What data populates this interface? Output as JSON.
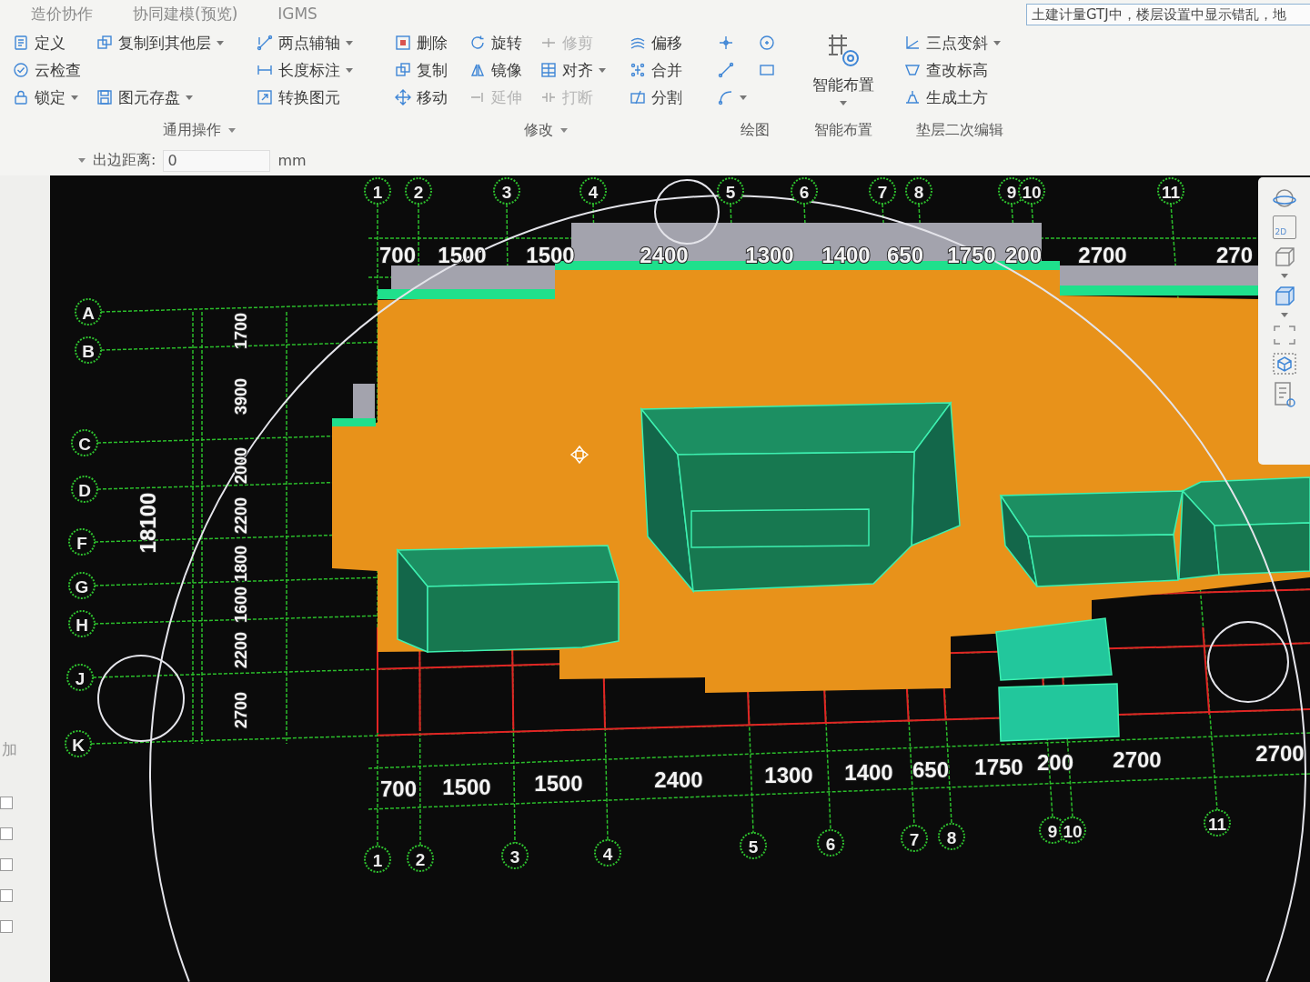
{
  "tabs": [
    {
      "label": "造价协作",
      "selected": false
    },
    {
      "label": "协同建模(预览)",
      "selected": false
    },
    {
      "label": "IGMS",
      "selected": false
    }
  ],
  "search": {
    "value": "土建计量GTJ中，楼层设置中显示错乱，地"
  },
  "ribbon": [
    {
      "label": "通用操作",
      "dropdown": true,
      "kind": "columns",
      "columns": [
        [
          {
            "label": "定义",
            "dropdown": false,
            "disabled": false
          },
          {
            "label": "云检查",
            "dropdown": false,
            "disabled": false
          },
          {
            "label": "锁定",
            "dropdown": true,
            "disabled": false
          }
        ],
        [
          {
            "label": "复制到其他层",
            "dropdown": true,
            "disabled": false
          },
          null,
          {
            "label": "图元存盘",
            "dropdown": true,
            "disabled": false
          }
        ],
        [
          {
            "label": "两点辅轴",
            "dropdown": true,
            "disabled": false
          },
          {
            "label": "长度标注",
            "dropdown": true,
            "disabled": false
          },
          {
            "label": "转换图元",
            "dropdown": false,
            "disabled": false
          }
        ]
      ]
    },
    {
      "label": "修改",
      "dropdown": true,
      "kind": "columns",
      "columns": [
        [
          {
            "label": "删除",
            "dropdown": false,
            "disabled": false
          },
          {
            "label": "复制",
            "dropdown": false,
            "disabled": false
          },
          {
            "label": "移动",
            "dropdown": false,
            "disabled": false
          }
        ],
        [
          {
            "label": "旋转",
            "dropdown": false,
            "disabled": false
          },
          {
            "label": "镜像",
            "dropdown": false,
            "disabled": false
          },
          {
            "label": "延伸",
            "dropdown": false,
            "disabled": true
          }
        ],
        [
          {
            "label": "修剪",
            "dropdown": false,
            "disabled": true
          },
          {
            "label": "对齐",
            "dropdown": true,
            "disabled": false
          },
          {
            "label": "打断",
            "dropdown": false,
            "disabled": true
          }
        ],
        [
          {
            "label": "偏移",
            "dropdown": false,
            "disabled": false
          },
          {
            "label": "合并",
            "dropdown": false,
            "disabled": false
          },
          {
            "label": "分割",
            "dropdown": false,
            "disabled": false
          }
        ]
      ]
    },
    {
      "label": "绘图",
      "dropdown": false,
      "kind": "icons",
      "columns": [
        [
          {
            "dropdown": false
          },
          {
            "dropdown": false
          },
          {
            "dropdown": true
          }
        ],
        [
          {
            "dropdown": false
          },
          {
            "dropdown": false
          }
        ]
      ]
    },
    {
      "label": "智能布置",
      "dropdown": false,
      "kind": "large",
      "button": {
        "label": "智能布置",
        "dropdown": true
      }
    },
    {
      "label": "垫层二次编辑",
      "dropdown": false,
      "kind": "columns",
      "columns": [
        [
          {
            "label": "三点变斜",
            "dropdown": true,
            "disabled": false
          },
          {
            "label": "查改标高",
            "dropdown": false,
            "disabled": false
          },
          {
            "label": "生成土方",
            "dropdown": false,
            "disabled": false
          }
        ]
      ]
    }
  ],
  "options_bar": {
    "label": "出边距离:",
    "value": "0",
    "unit": "mm"
  },
  "left_panel": {
    "label": "加",
    "checkboxes": [
      {
        "checked": false
      },
      {
        "checked": false
      },
      {
        "checked": false
      },
      {
        "checked": false
      },
      {
        "checked": false
      }
    ]
  },
  "canvas": {
    "top_axes": [
      "1",
      "2",
      "3",
      "4",
      "5",
      "6",
      "7",
      "8",
      "9",
      "10",
      "11"
    ],
    "bottom_axes": [
      "1",
      "2",
      "3",
      "4",
      "5",
      "6",
      "7",
      "8",
      "9",
      "10",
      "11"
    ],
    "left_axes": [
      "A",
      "B",
      "C",
      "D",
      "F",
      "G",
      "H",
      "J",
      "K"
    ],
    "top_dimensions": [
      "700",
      "1500",
      "1500",
      "2400",
      "1300",
      "1400",
      "650",
      "1750",
      "200",
      "2700",
      "270"
    ],
    "bottom_dimensions": [
      "700",
      "1500",
      "1500",
      "2400",
      "1300",
      "1400",
      "650",
      "1750",
      "200",
      "2700",
      "2700"
    ],
    "left_dimensions": [
      "1700",
      "3900",
      "2000",
      "2200",
      "1800",
      "1600",
      "2200",
      "2700"
    ],
    "total_dimension": "18100"
  },
  "view_toolbar": {
    "label": "2D"
  }
}
